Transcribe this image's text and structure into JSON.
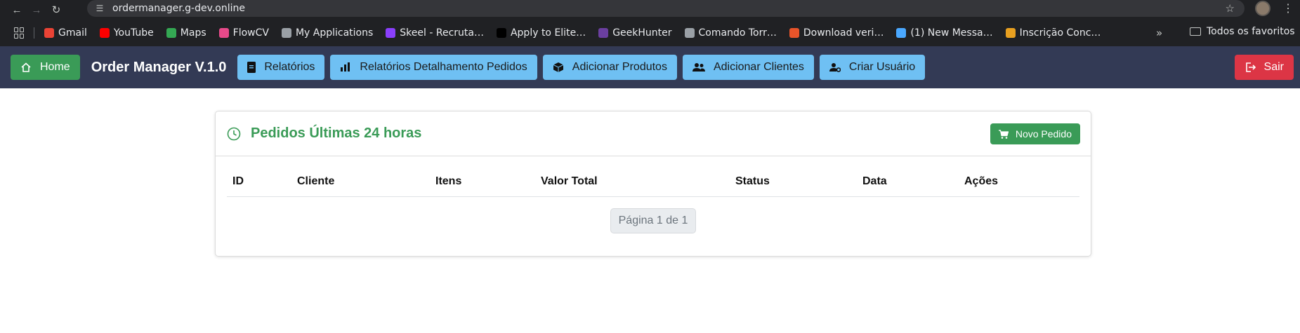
{
  "browser": {
    "url": "ordermanager.g-dev.online",
    "bookmarks": [
      {
        "label": "Gmail",
        "icon": "gmail-icon",
        "color": "#ea4335"
      },
      {
        "label": "YouTube",
        "icon": "youtube-icon",
        "color": "#ff0000"
      },
      {
        "label": "Maps",
        "icon": "maps-icon",
        "color": "#34a853"
      },
      {
        "label": "FlowCV",
        "icon": "flowcv-icon",
        "color": "#e84a8a"
      },
      {
        "label": "My Applications",
        "icon": "globe-icon",
        "color": "#9aa0a6"
      },
      {
        "label": "Skeel - Recruta…",
        "icon": "skeel-icon",
        "color": "#8a3ffc"
      },
      {
        "label": "Apply to Elite…",
        "icon": "elite-icon",
        "color": "#000000"
      },
      {
        "label": "GeekHunter",
        "icon": "geekhunter-icon",
        "color": "#6b3fa0"
      },
      {
        "label": "Comando Torr…",
        "icon": "wordpress-icon",
        "color": "#9aa0a6"
      },
      {
        "label": "Download veri…",
        "icon": "download-x-icon",
        "color": "#e8542a"
      },
      {
        "label": "(1) New Messa…",
        "icon": "play-icon",
        "color": "#4aa8ff"
      },
      {
        "label": "Inscrição Conc…",
        "icon": "inscricao-icon",
        "color": "#e8a020"
      }
    ],
    "all_bookmarks": "Todos os favoritos"
  },
  "navbar": {
    "home": "Home",
    "brand": "Order Manager V.1.0",
    "buttons": [
      {
        "label": "Relatórios",
        "icon": "document-icon"
      },
      {
        "label": "Relatórios Detalhamento Pedidos",
        "icon": "bar-chart-icon"
      },
      {
        "label": "Adicionar Produtos",
        "icon": "box-icon"
      },
      {
        "label": "Adicionar Clientes",
        "icon": "users-icon"
      },
      {
        "label": "Criar Usuário",
        "icon": "user-cog-icon"
      }
    ],
    "logout": "Sair"
  },
  "card": {
    "title": "Pedidos Últimas 24 horas",
    "new_order": "Novo Pedido",
    "columns": [
      "ID",
      "Cliente",
      "Itens",
      "Valor Total",
      "Status",
      "Data",
      "Ações"
    ],
    "pagination": "Página 1 de 1"
  },
  "colors": {
    "success": "#3a9b57",
    "info": "#6fc0f3",
    "danger": "#dc3545",
    "navbar": "#333a55"
  }
}
